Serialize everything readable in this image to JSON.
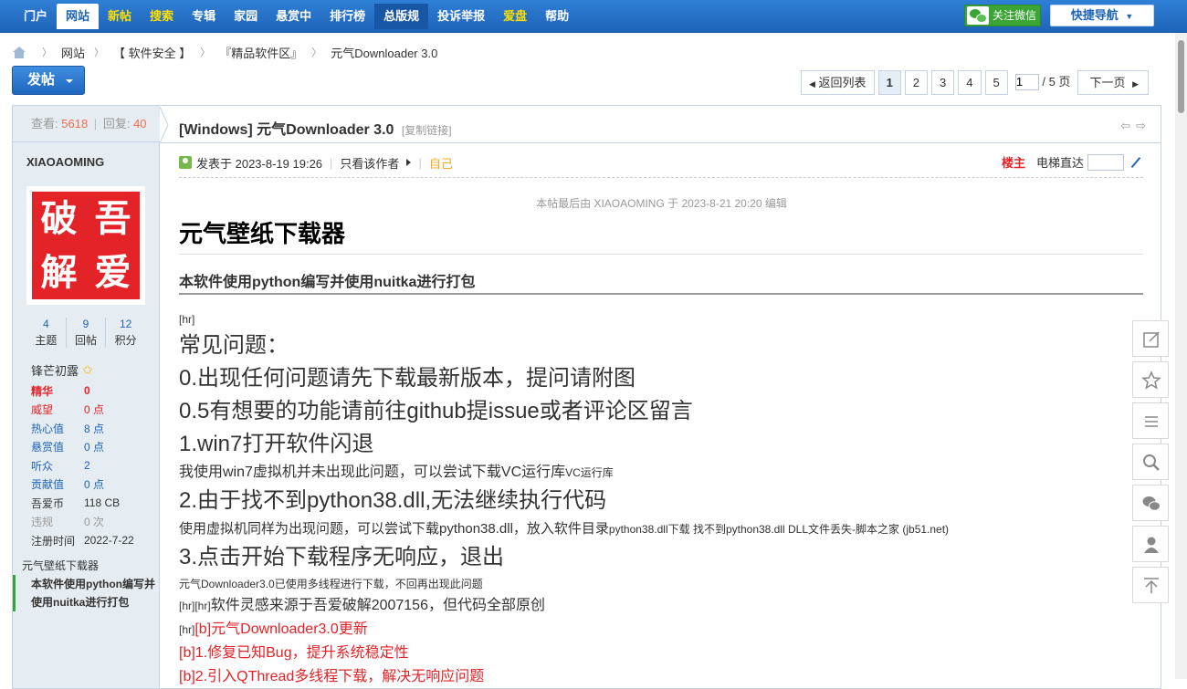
{
  "topnav": {
    "items": [
      {
        "label": "门户",
        "style": "normal"
      },
      {
        "label": "网站",
        "style": "active"
      },
      {
        "label": "新帖",
        "style": "yellow"
      },
      {
        "label": "搜索",
        "style": "yellow"
      },
      {
        "label": "专辑",
        "style": "normal"
      },
      {
        "label": "家园",
        "style": "normal"
      },
      {
        "label": "悬赏中",
        "style": "normal"
      },
      {
        "label": "排行榜",
        "style": "normal"
      },
      {
        "label": "总版规",
        "style": "search"
      },
      {
        "label": "投诉举报",
        "style": "normal"
      },
      {
        "label": "爱盘",
        "style": "yellow"
      },
      {
        "label": "帮助",
        "style": "normal"
      }
    ],
    "wechat_label": "关注微信",
    "quicknav_label": "快捷导航"
  },
  "breadcrumb": [
    "网站",
    "【 软件安全 】",
    "『精品软件区』",
    "元气Downloader 3.0"
  ],
  "post_button": "发帖",
  "pager": {
    "back": "返回列表",
    "pages": [
      "1",
      "2",
      "3",
      "4",
      "5"
    ],
    "current": "1",
    "total": "/ 5 页",
    "next": "下一页"
  },
  "stats": {
    "view_label": "查看:",
    "views": "5618",
    "reply_label": "回复:",
    "replies": "40"
  },
  "author": {
    "name": "XIAOAOMING",
    "avatar_chars": [
      "破",
      "吾",
      "解",
      "爱"
    ],
    "counts": [
      {
        "value": "4",
        "label": "主题"
      },
      {
        "value": "9",
        "label": "回帖"
      },
      {
        "value": "12",
        "label": "积分"
      }
    ],
    "rank": "锋芒初露",
    "info": [
      {
        "key": "精华",
        "value": "0",
        "kcolor": "#e32328",
        "vcolor": "#e32328",
        "bold": true
      },
      {
        "key": "威望",
        "value": "0 点",
        "kcolor": "#e32328",
        "vcolor": "#e32328",
        "bold": false
      },
      {
        "key": "热心值",
        "value": "8 点",
        "kcolor": "#1e64b8",
        "vcolor": "#1e64b8",
        "bold": false
      },
      {
        "key": "悬赏值",
        "value": "0 点",
        "kcolor": "#1e64b8",
        "vcolor": "#1e64b8",
        "bold": false
      },
      {
        "key": "听众",
        "value": "2",
        "kcolor": "#1e64b8",
        "vcolor": "#1e64b8",
        "bold": false
      },
      {
        "key": "贡献值",
        "value": "0 点",
        "kcolor": "#1e64b8",
        "vcolor": "#1e64b8",
        "bold": false
      },
      {
        "key": "吾爱币",
        "value": "118 CB",
        "kcolor": "#333333",
        "vcolor": "#333333",
        "bold": false
      },
      {
        "key": "违规",
        "value": "0 次",
        "kcolor": "#999999",
        "vcolor": "#999999",
        "bold": false
      },
      {
        "key": "注册时间",
        "value": "2022-7-22",
        "kcolor": "#333333",
        "vcolor": "#333333",
        "bold": false
      }
    ]
  },
  "toc": {
    "title": "元气壁纸下载器",
    "item": "本软件使用python编写并使用nuitka进行打包"
  },
  "thread": {
    "title": "[Windows] 元气Downloader 3.0",
    "copy_link": "[复制链接]",
    "posted": "发表于 2023-8-19 19:26",
    "only_author": "只看该作者",
    "self": "自己",
    "floor": "楼主",
    "elevator": "电梯直达",
    "edit_note": "本帖最后由 XIAOAOMING 于 2023-8-21 20:20 编辑"
  },
  "body": {
    "h1": "元气壁纸下载器",
    "h3": "本软件使用python编写并使用nuitka进行打包",
    "hr_tag": "[hr]",
    "faq_title": "常见问题：",
    "q0": "0.出现任何问题请先下载最新版本，提问请附图",
    "q05": "0.5有想要的功能请前往github提issue或者评论区留言",
    "q1": "1.win7打开软件闪退",
    "a1": "我使用win7虚拟机并未出现此问题，可以尝试下载VC运行库",
    "a1_small": "VC运行库",
    "q2": "2.由于找不到python38.dll,无法继续执行代码",
    "a2": "使用虚拟机同样为出现问题，可以尝试下载python38.dll，放入软件目录",
    "a2_small": "python38.dll下载 找不到python38.dll DLL文件丢失-脚本之家 (jb51.net)",
    "q3": "3.点击开始下载程序无响应，退出",
    "a3": "元气Downloader3.0已使用多线程进行下载，不回再出现此问题",
    "hrhr": "[hr][hr]",
    "credit": "软件灵感来源于吾爱破解2007156，但代码全部原创",
    "update_tag": "[hr]",
    "update_title": "[b]元气Downloader3.0更新",
    "u1": "[b]1.修复已知Bug，提升系统稳定性",
    "u2": "[b]2.引入QThread多线程下载，解决无响应问题"
  }
}
